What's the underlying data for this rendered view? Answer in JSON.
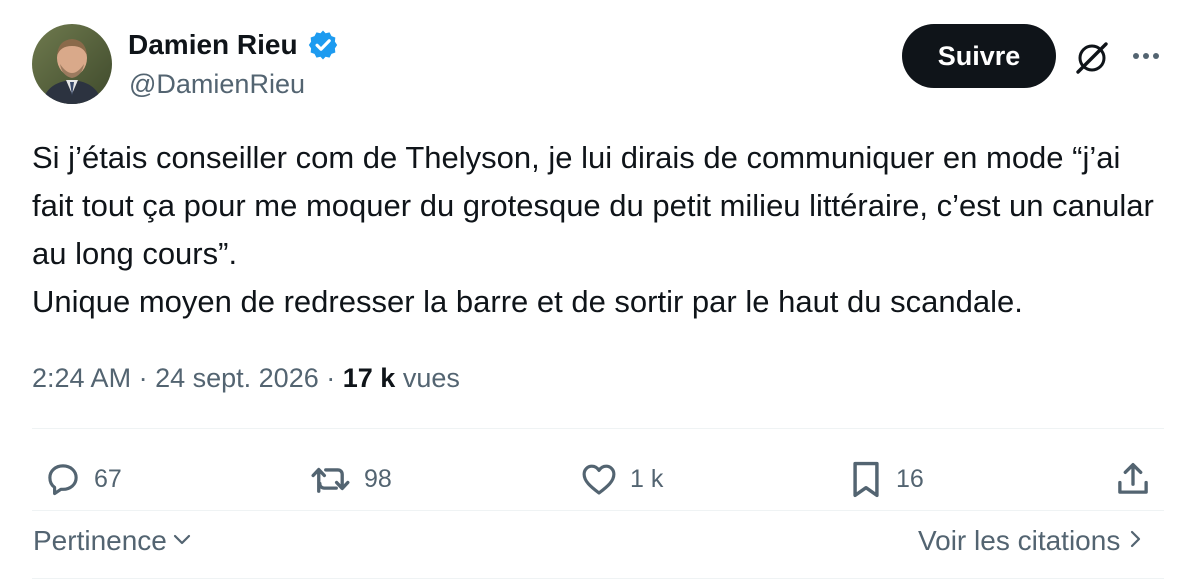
{
  "author": {
    "name": "Damien Rieu",
    "handle": "@DamienRieu",
    "verified": true,
    "verified_color": "#1d9bf0"
  },
  "follow_button": {
    "label": "Suivre"
  },
  "tweet": {
    "lines": [
      "Si j’étais conseiller com de Thelyson, je lui dirais de communiquer en mode “j’ai fait tout ça pour me moquer du grotesque du petit milieu littéraire, c’est un canular au long cours”.",
      "Unique moyen de redresser la barre et de sortir par le haut du scandale."
    ]
  },
  "meta": {
    "time": "2:24 AM",
    "separator": "·",
    "date": "24 sept. 2026",
    "views_count": "17 k",
    "views_label": "vues"
  },
  "actions": {
    "replies": "67",
    "reposts": "98",
    "likes": "1 k",
    "bookmarks": "16"
  },
  "footer": {
    "sort_label": "Pertinence",
    "quotes_label": "Voir les citations"
  },
  "colors": {
    "text": "#0f1419",
    "secondary": "#536471",
    "divider": "#eff3f4",
    "button_bg": "#0f1419"
  },
  "icons": [
    "verified-badge-icon",
    "grok-icon",
    "more-icon",
    "reply-icon",
    "repost-icon",
    "like-icon",
    "bookmark-icon",
    "share-icon",
    "chevron-down-icon",
    "chevron-right-icon"
  ]
}
